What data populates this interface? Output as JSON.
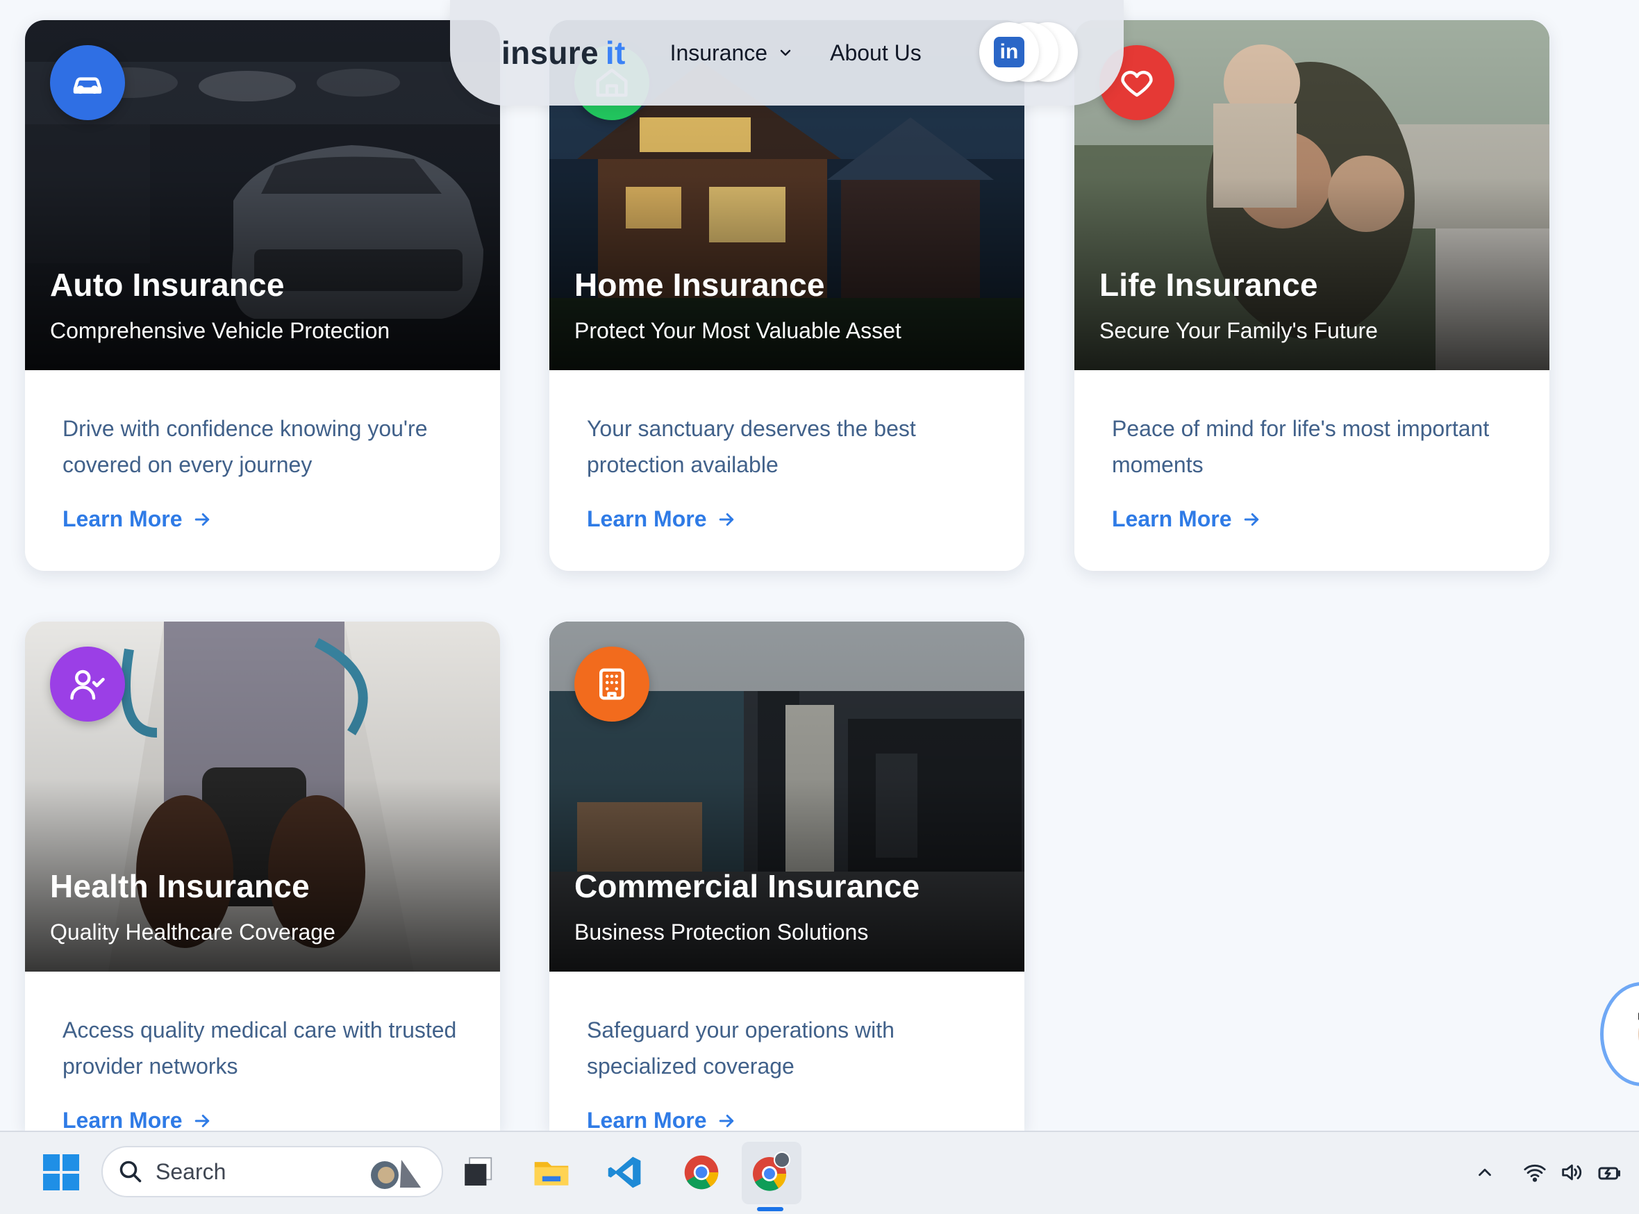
{
  "navbar": {
    "logo_main": "insure",
    "logo_accent": "it",
    "insurance_label": "Insurance",
    "about_label": "About Us"
  },
  "cards": [
    {
      "title": "Auto Insurance",
      "subtitle": "Comprehensive Vehicle Protection",
      "description": "Drive with confidence knowing you're covered on every journey",
      "link": "Learn More",
      "badge_color": "#2f6fe4",
      "icon": "car-icon"
    },
    {
      "title": "Home Insurance",
      "subtitle": "Protect Your Most Valuable Asset",
      "description": "Your sanctuary deserves the best protection available",
      "link": "Learn More",
      "badge_color": "#22c55e",
      "icon": "home-icon"
    },
    {
      "title": "Life Insurance",
      "subtitle": "Secure Your Family's Future",
      "description": "Peace of mind for life's most important moments",
      "link": "Learn More",
      "badge_color": "#e53935",
      "icon": "heart-icon"
    },
    {
      "title": "Health Insurance",
      "subtitle": "Quality Healthcare Coverage",
      "description": "Access quality medical care with trusted provider networks",
      "link": "Learn More",
      "badge_color": "#9b3fe6",
      "icon": "user-check-icon"
    },
    {
      "title": "Commercial Insurance",
      "subtitle": "Business Protection Solutions",
      "description": "Safeguard your operations with specialized coverage",
      "link": "Learn More",
      "badge_color": "#f26b1d",
      "icon": "building-icon"
    }
  ],
  "taskbar": {
    "search_placeholder": "Search"
  },
  "colors": {
    "accent": "#2f7be6",
    "description_text": "#41618a"
  }
}
